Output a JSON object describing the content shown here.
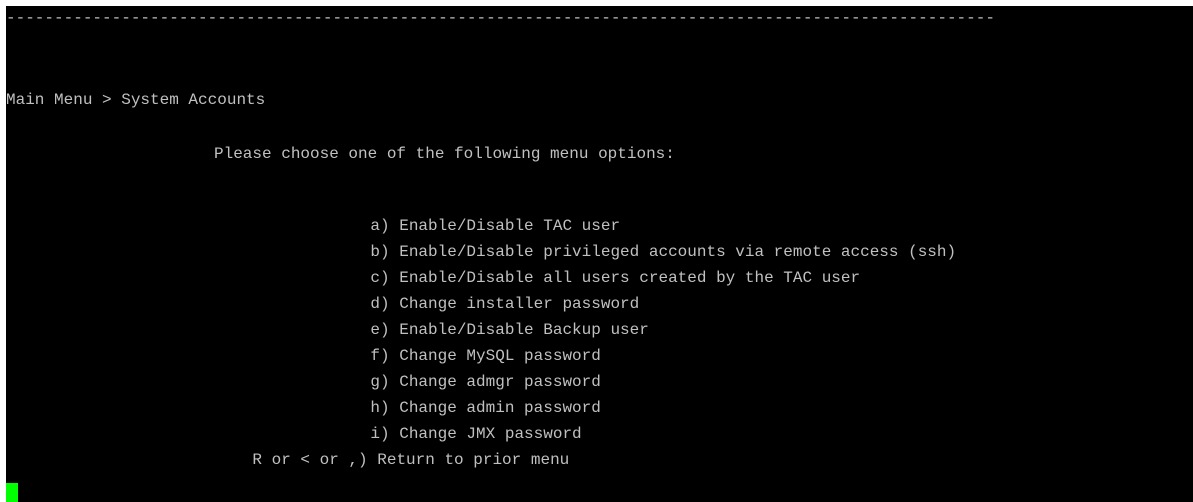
{
  "terminal": {
    "rule": "-------------------------------------------------------------------------------------------------------",
    "breadcrumb": "Main Menu > System Accounts",
    "prompt": "Please choose one of the following menu options:",
    "options": [
      {
        "key": "a)",
        "label": "Enable/Disable TAC user"
      },
      {
        "key": "b)",
        "label": "Enable/Disable privileged accounts via remote access (ssh)"
      },
      {
        "key": "c)",
        "label": "Enable/Disable all users created by the TAC user"
      },
      {
        "key": "d)",
        "label": "Change installer password"
      },
      {
        "key": "e)",
        "label": "Enable/Disable Backup user"
      },
      {
        "key": "f)",
        "label": "Change MySQL password"
      },
      {
        "key": "g)",
        "label": "Change admgr password"
      },
      {
        "key": "h)",
        "label": "Change admin password"
      },
      {
        "key": "i)",
        "label": "Change JMX password"
      },
      {
        "key": "R or < or ,)",
        "label": "Return to prior menu"
      }
    ],
    "colors": {
      "background": "#000000",
      "text": "#c0c0c0",
      "cursor": "#00ff00"
    }
  }
}
